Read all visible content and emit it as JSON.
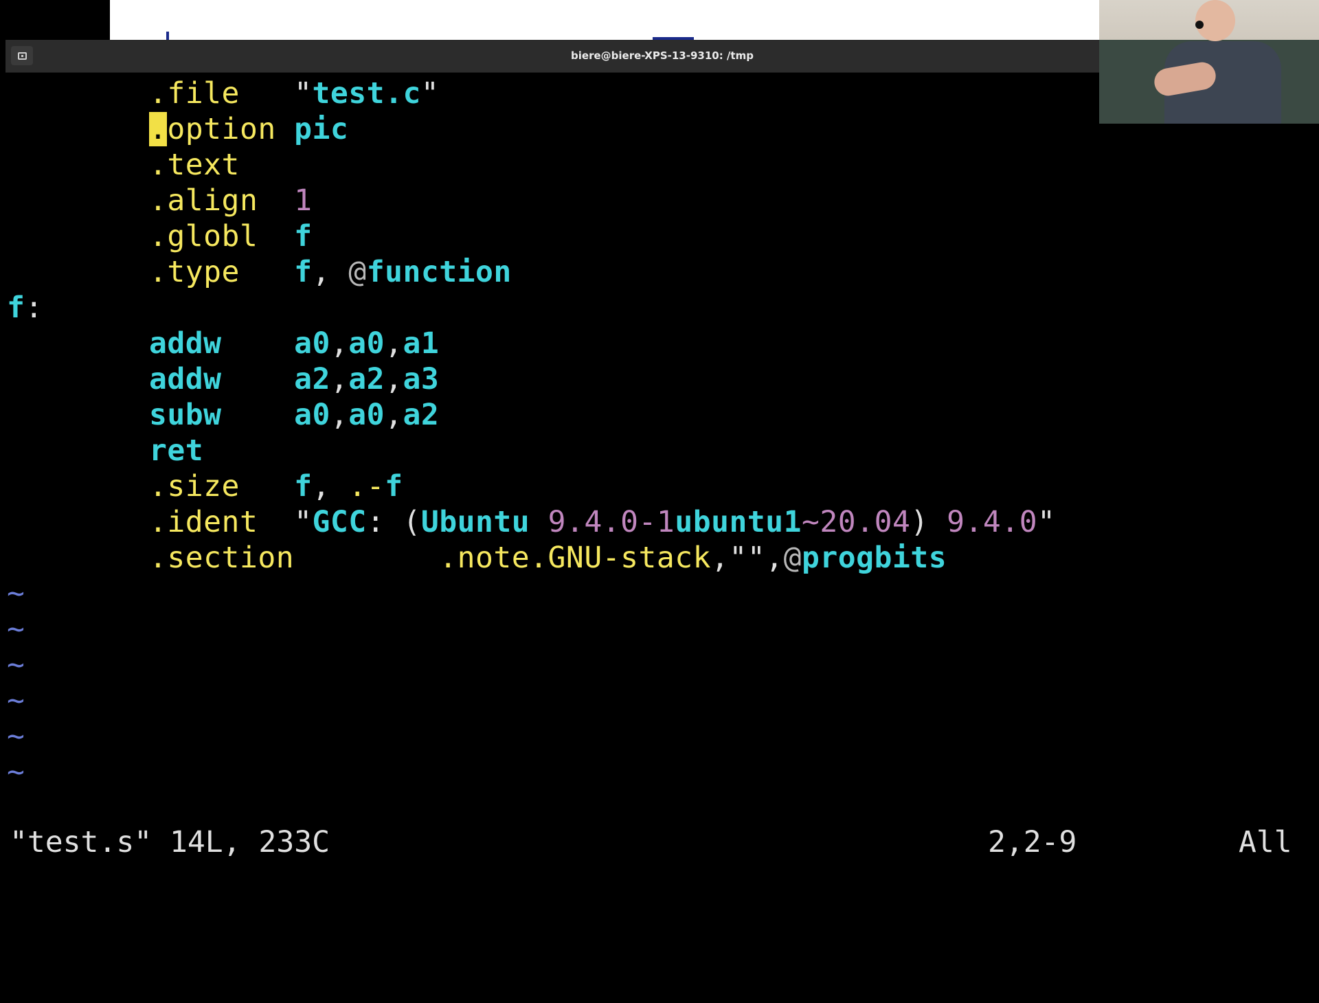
{
  "window": {
    "title": "biere@biere-XPS-13-9310: /tmp",
    "menu_icon": "terminal-menu-icon"
  },
  "editor": {
    "lines": [
      [
        {
          "t": ".file",
          "k": "y"
        },
        {
          "t": "   \"",
          "k": "w"
        },
        {
          "t": "test.c",
          "k": "c"
        },
        {
          "t": "\"",
          "k": "w"
        }
      ],
      [
        {
          "t": ".",
          "k": "cursor"
        },
        {
          "t": "option",
          "k": "y"
        },
        {
          "t": " ",
          "k": "w"
        },
        {
          "t": "pic",
          "k": "c"
        }
      ],
      [
        {
          "t": ".text",
          "k": "y"
        }
      ],
      [
        {
          "t": ".align",
          "k": "y"
        },
        {
          "t": "  ",
          "k": "w"
        },
        {
          "t": "1",
          "k": "m"
        }
      ],
      [
        {
          "t": ".globl",
          "k": "y"
        },
        {
          "t": "  ",
          "k": "w"
        },
        {
          "t": "f",
          "k": "c"
        }
      ],
      [
        {
          "t": ".type",
          "k": "y"
        },
        {
          "t": "   ",
          "k": "w"
        },
        {
          "t": "f",
          "k": "c"
        },
        {
          "t": ", ",
          "k": "w"
        },
        {
          "t": "@",
          "k": "g"
        },
        {
          "t": "function",
          "k": "c"
        }
      ],
      [
        {
          "t": "f",
          "k": "c"
        },
        {
          "t": ":",
          "k": "w"
        }
      ],
      [
        {
          "t": "addw",
          "k": "c"
        },
        {
          "t": "    ",
          "k": "w"
        },
        {
          "t": "a0",
          "k": "c"
        },
        {
          "t": ",",
          "k": "w"
        },
        {
          "t": "a0",
          "k": "c"
        },
        {
          "t": ",",
          "k": "w"
        },
        {
          "t": "a1",
          "k": "c"
        }
      ],
      [
        {
          "t": "addw",
          "k": "c"
        },
        {
          "t": "    ",
          "k": "w"
        },
        {
          "t": "a2",
          "k": "c"
        },
        {
          "t": ",",
          "k": "w"
        },
        {
          "t": "a2",
          "k": "c"
        },
        {
          "t": ",",
          "k": "w"
        },
        {
          "t": "a3",
          "k": "c"
        }
      ],
      [
        {
          "t": "subw",
          "k": "c"
        },
        {
          "t": "    ",
          "k": "w"
        },
        {
          "t": "a0",
          "k": "c"
        },
        {
          "t": ",",
          "k": "w"
        },
        {
          "t": "a0",
          "k": "c"
        },
        {
          "t": ",",
          "k": "w"
        },
        {
          "t": "a2",
          "k": "c"
        }
      ],
      [
        {
          "t": "ret",
          "k": "c"
        }
      ],
      [
        {
          "t": ".size",
          "k": "y"
        },
        {
          "t": "   ",
          "k": "w"
        },
        {
          "t": "f",
          "k": "c"
        },
        {
          "t": ", ",
          "k": "w"
        },
        {
          "t": ".-",
          "k": "y"
        },
        {
          "t": "f",
          "k": "c"
        }
      ],
      [
        {
          "t": ".ident",
          "k": "y"
        },
        {
          "t": "  \"",
          "k": "w"
        },
        {
          "t": "GCC",
          "k": "c"
        },
        {
          "t": ": (",
          "k": "w"
        },
        {
          "t": "Ubuntu",
          "k": "c"
        },
        {
          "t": " ",
          "k": "w"
        },
        {
          "t": "9.4.0-1",
          "k": "m"
        },
        {
          "t": "ubuntu1",
          "k": "c"
        },
        {
          "t": "~20.04",
          "k": "m"
        },
        {
          "t": ") ",
          "k": "w"
        },
        {
          "t": "9.4.0",
          "k": "m"
        },
        {
          "t": "\"",
          "k": "w"
        }
      ],
      [
        {
          "t": ".section",
          "k": "y"
        },
        {
          "t": "        ",
          "k": "w"
        },
        {
          "t": ".note.GNU-stack",
          "k": "y"
        },
        {
          "t": ",\"\",",
          "k": "w"
        },
        {
          "t": "@",
          "k": "g"
        },
        {
          "t": "progbits",
          "k": "c"
        }
      ]
    ],
    "indented": [
      true,
      true,
      true,
      true,
      true,
      true,
      false,
      true,
      true,
      true,
      true,
      true,
      true,
      true
    ],
    "tilde": "~",
    "tilde_count": 6
  },
  "status": {
    "message": "\"test.s\" 14L, 233C",
    "position": "2,2-9",
    "scroll": "All"
  },
  "colors": {
    "directive": "#f6e85f",
    "identifier": "#3fd4dc",
    "number": "#c086be",
    "cursor": "#f2e046",
    "background": "#000000"
  }
}
